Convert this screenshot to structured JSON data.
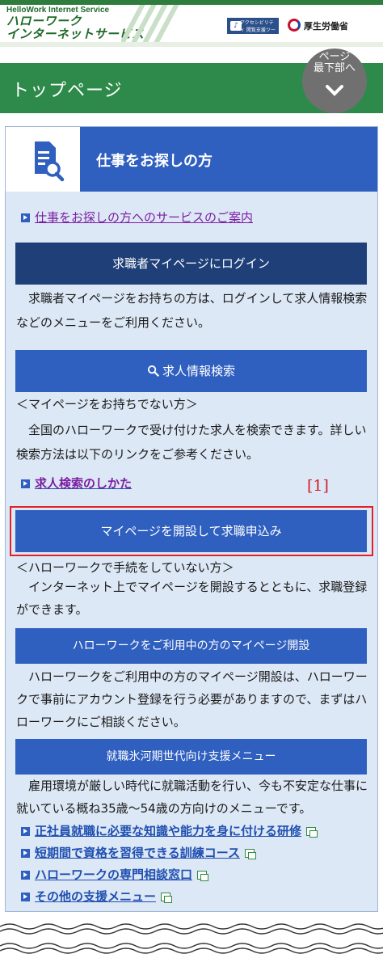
{
  "header": {
    "logo_en": "HelloWork Internet Service",
    "logo_jp_line1": "ハローワーク",
    "logo_jp_line2": "インターネットサービス",
    "accessibility_label": "アクセシビリティ 閲覧支援ツール",
    "ministry_name": "厚生労働省"
  },
  "title_bar": {
    "page_title": "トップページ",
    "to_bottom_line1": "ページ",
    "to_bottom_line2": "最下部へ"
  },
  "card": {
    "title": "仕事をお探しの方",
    "service_link": "仕事をお探しの方へのサービスのご案内",
    "login_button": "求職者マイページにログイン",
    "login_desc": "　求職者マイページをお持ちの方は、ログインして求人情報検索などのメニューをご利用ください。",
    "search_button": "求人情報検索",
    "no_mypage_note": "＜マイページをお持ちでない方＞",
    "search_desc": "　全国のハローワークで受け付けた求人を検索できます。詳しい検索方法は以下のリンクをご参考ください。",
    "howto_link": "求人検索のしかた",
    "marker": "[1]",
    "register_button": "マイページを開設して求職申込み",
    "not_registered_note": "＜ハローワークで手続をしていない方＞",
    "register_desc": "　インターネット上でマイページを開設するとともに、求職登録ができます。",
    "existing_button": "ハローワークをご利用中の方のマイページ開設",
    "existing_desc": "　ハローワークをご利用中の方のマイページ開設は、ハローワークで事前にアカウント登録を行う必要がありますので、まずはハローワークにご相談ください。",
    "ice_age_button": "就職氷河期世代向け支援メニュー",
    "ice_age_desc": "　雇用環境が厳しい時代に就職活動を行い、今も不安定な仕事に就いている概ね35歳～54歳の方向けのメニューです。",
    "support_links": [
      "正社員就職に必要な知識や能力を身に付ける研修",
      "短期間で資格を習得できる訓練コース",
      "ハローワークの専門相談窓口",
      "その他の支援メニュー"
    ]
  },
  "colors": {
    "brand_green": "#2d8a4a",
    "card_blue": "#2f5fbf",
    "button_dark": "#1f3f78",
    "card_bg": "#dde8f6",
    "highlight_red": "#e0202a"
  }
}
